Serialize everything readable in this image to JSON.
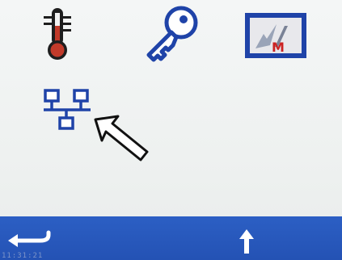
{
  "main_icons": [
    {
      "name": "temperature-icon"
    },
    {
      "name": "key-icon"
    },
    {
      "name": "logo-icon"
    },
    {
      "name": "network-icon"
    }
  ],
  "bottom_bar": {
    "back_icon": "back-arrow-icon",
    "up_icon": "up-arrow-icon",
    "status_text": "11:31:21"
  },
  "colors": {
    "bar": "#2a5bbf",
    "screen_bg": "#f1f4f3",
    "icon_blue": "#1f43a8",
    "thermo_red": "#c23a2a"
  }
}
